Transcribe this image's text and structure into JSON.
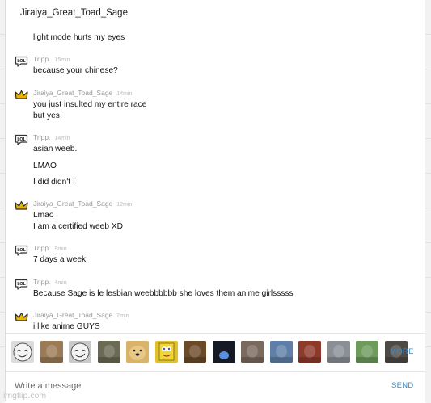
{
  "chat": {
    "title": "Jiraiya_Great_Toad_Sage",
    "intro_message": "light mode hurts my eyes",
    "groups": [
      {
        "author": "Tripp.",
        "time": "15min",
        "icon": "lol-speech-bubble-icon",
        "lines": [
          "because your chinese?"
        ]
      },
      {
        "author": "Jiraiya_Great_Toad_Sage",
        "time": "14min",
        "icon": "crown-icon",
        "lines": [
          "you just insulted my entire race",
          "but yes"
        ]
      },
      {
        "author": "Tripp.",
        "time": "14min",
        "icon": "lol-speech-bubble-icon",
        "lines": [
          "asian weeb.",
          "LMAO",
          "I did didn't I"
        ]
      },
      {
        "author": "Jiraiya_Great_Toad_Sage",
        "time": "12min",
        "icon": "crown-icon",
        "lines": [
          "Lmao",
          "I am a certified weeb XD"
        ]
      },
      {
        "author": "Tripp.",
        "time": "9min",
        "icon": "lol-speech-bubble-icon",
        "lines": [
          "7 days a week."
        ]
      },
      {
        "author": "Tripp.",
        "time": "4min",
        "icon": "lol-speech-bubble-icon",
        "lines": [
          "Because Sage is le lesbian weebbbbbb she loves them anime girlsssss"
        ]
      },
      {
        "author": "Jiraiya_Great_Toad_Sage",
        "time": "2min",
        "icon": "crown-icon",
        "lines": [
          "i like anime GUYS"
        ]
      }
    ]
  },
  "meme_bar": {
    "more_label": "MORE",
    "memes": [
      {
        "name": "trollface-meme",
        "color": "#dcdcdc"
      },
      {
        "name": "jesus-meme",
        "color": "#9b7b55"
      },
      {
        "name": "troll-face-meme",
        "color": "#c9c9c9"
      },
      {
        "name": "doge-dark-meme",
        "color": "#6b6a55"
      },
      {
        "name": "doge-meme",
        "color": "#d9b36a"
      },
      {
        "name": "spongebob-meme",
        "color": "#e0c22e"
      },
      {
        "name": "person-meme",
        "color": "#6b4a2a"
      },
      {
        "name": "blue-dark-meme",
        "color": "#1f2a44"
      },
      {
        "name": "woman-meme",
        "color": "#7a6a5d"
      },
      {
        "name": "sky-meme",
        "color": "#5f7fa8"
      },
      {
        "name": "red-meme",
        "color": "#8d3a2a"
      },
      {
        "name": "crowd-meme",
        "color": "#8a8f96"
      },
      {
        "name": "green-sky-meme",
        "color": "#6e9a5c"
      },
      {
        "name": "man-meme",
        "color": "#4e4a45"
      }
    ]
  },
  "compose": {
    "placeholder": "Write a message",
    "send_label": "SEND"
  },
  "watermark": "imgflip.com",
  "colors": {
    "link": "#3a8ac6",
    "meta": "#999999",
    "crown": "#e8b400"
  }
}
